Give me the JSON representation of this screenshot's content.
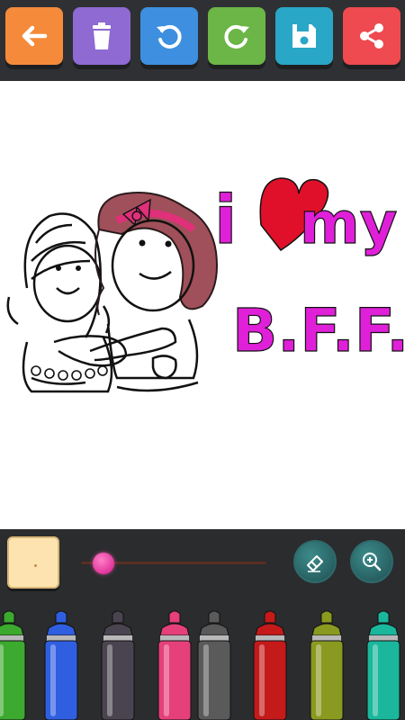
{
  "toolbar": {
    "buttons": [
      {
        "name": "back-button",
        "icon": "back-arrow-icon",
        "color": "#f58a3a"
      },
      {
        "name": "delete-button",
        "icon": "trash-icon",
        "color": "#8e6ad2"
      },
      {
        "name": "undo-button",
        "icon": "undo-icon",
        "color": "#3e8fe0"
      },
      {
        "name": "redo-button",
        "icon": "redo-icon",
        "color": "#6cb547"
      },
      {
        "name": "save-button",
        "icon": "save-icon",
        "color": "#2aa7c6"
      },
      {
        "name": "share-button",
        "icon": "share-icon",
        "color": "#ee4a4f"
      }
    ]
  },
  "canvas": {
    "title_text": {
      "line1_i": "i",
      "line1_my": "my",
      "line2": "B.F.F.!"
    },
    "text_color": "#e020d8",
    "heart_color": "#e0102a"
  },
  "controls": {
    "current_color": "#fde3b0",
    "brush_size_fraction": 0.12,
    "slider_color": "#e0209a",
    "eraser_icon": "eraser-icon",
    "zoom_icon": "zoom-in-icon"
  },
  "markers": [
    {
      "name": "green",
      "color": "#3ca92f"
    },
    {
      "name": "blue",
      "color": "#2f5fe0"
    },
    {
      "name": "dark-gray",
      "color": "#4a4450"
    },
    {
      "name": "pink",
      "color": "#e5407a"
    },
    {
      "name": "gray",
      "color": "#5a5a5a"
    },
    {
      "name": "red",
      "color": "#c41a1a"
    },
    {
      "name": "olive",
      "color": "#8a9a20"
    },
    {
      "name": "teal",
      "color": "#1ab79c"
    }
  ]
}
